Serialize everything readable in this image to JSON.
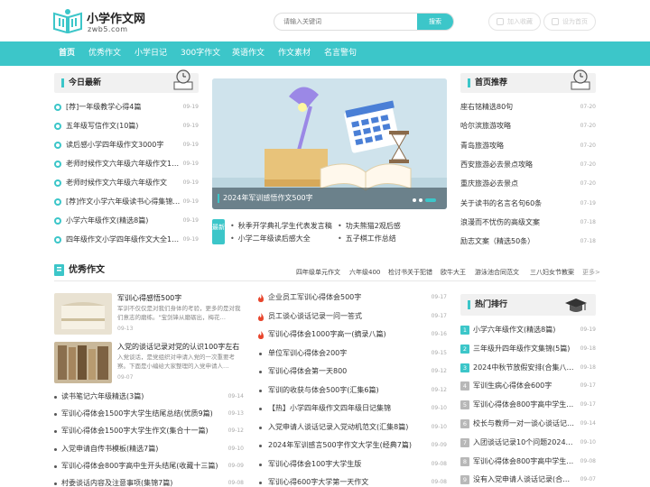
{
  "site": {
    "title": "小学作文网",
    "subtitle": "zwb5.com",
    "search_placeholder": "请输入关键词",
    "search_button": "搜索",
    "btn_favorite": "加入收藏",
    "btn_home": "设为首页"
  },
  "colors": {
    "accent": "#3cc6c9"
  },
  "nav": [
    "首页",
    "优秀作文",
    "小学日记",
    "300字作文",
    "英语作文",
    "作文素材",
    "名言警句"
  ],
  "latest": {
    "title": "今日最新",
    "items": [
      {
        "text": "[荐]一年级教学心得4篇",
        "date": "09-19"
      },
      {
        "text": "五年级写信作文(10篇)",
        "date": "09-19"
      },
      {
        "text": "读后感小学四年级作文3000字",
        "date": "09-19"
      },
      {
        "text": "老师时候作文六年级六年级作文1…",
        "date": "09-19"
      },
      {
        "text": "老师时候作文六年级六年级作文",
        "date": "09-19"
      },
      {
        "text": "[荐]作文小学六年级读书心得集锦…",
        "date": "09-19"
      },
      {
        "text": "小学六年级作文(精选8篇)",
        "date": "09-19"
      },
      {
        "text": "四年级作文小学四年级作文大全1…",
        "date": "09-19"
      }
    ]
  },
  "banner": {
    "caption": "2024年军训感悟作文500字"
  },
  "newest": {
    "badge": "最新",
    "items": [
      "秋季开学典礼学生代表发言稿",
      "功夫熊猫2观后感",
      "小学二年级读后感大全",
      "五子棋工作总结"
    ]
  },
  "recommend": {
    "title": "首页推荐",
    "items": [
      {
        "text": "座右铭精选80句",
        "date": "07-20"
      },
      {
        "text": "哈尔滨旅游攻略",
        "date": "07-20"
      },
      {
        "text": "青岛旅游攻略",
        "date": "07-20"
      },
      {
        "text": "西安旅游必去景点攻略",
        "date": "07-20"
      },
      {
        "text": "重庆旅游必去景点",
        "date": "07-20"
      },
      {
        "text": "关于读书的名言名句60条",
        "date": "07-19"
      },
      {
        "text": "浪漫而不忧伤的高级文案",
        "date": "07-18"
      },
      {
        "text": "励志文案（精选50条）",
        "date": "07-18"
      }
    ]
  },
  "excellent": {
    "title": "优秀作文",
    "tags": [
      "四年级单元作文",
      "六年级400",
      "检讨书关于犯错",
      "欧牛大王",
      "游泳池合同范文",
      "三八妇女节教案",
      "更多>"
    ],
    "cards": [
      {
        "title": "军训心得感悟500字",
        "desc": "军训不仅仅是对我们身体的考验，更多的是对我们意志的磨练。\"宝剑锋从磨砺出，梅花…",
        "date": "09-13"
      },
      {
        "title": "入党的谈话记录对党的认识100字左右",
        "desc": "入党谈话，是党组织对申请入党的一次重要考察。下面是小编给大家整理的入党申请人…",
        "date": "09-07"
      }
    ],
    "left_list": [
      {
        "text": "读书笔记六年级精选(3篇)",
        "date": "09-14"
      },
      {
        "text": "军训心得体会1500字大学生结尾总结(优质9篇)",
        "date": "09-13"
      },
      {
        "text": "军训心得体会1500字大学生作文(集合十一篇)",
        "date": "09-12"
      },
      {
        "text": "入党申请自传书模板(精选7篇)",
        "date": "09-10"
      },
      {
        "text": "军训心得体会800字高中生开头结尾(收藏十三篇)",
        "date": "09-09"
      },
      {
        "text": "村委谈话内容及注意事项(集锦7篇)",
        "date": "09-08"
      }
    ],
    "mid_list": [
      {
        "text": "企业员工军训心得体会500字",
        "date": "09-17",
        "hot": true
      },
      {
        "text": "员工谈心谈话记录一问一答式",
        "date": "09-17",
        "hot": true
      },
      {
        "text": "军训心得体会1000字高一(摘录八篇)",
        "date": "09-16",
        "hot": true
      },
      {
        "text": "单位军训心得体会200字",
        "date": "09-15",
        "hot": false
      },
      {
        "text": "军训心得体会第一天800",
        "date": "09-12",
        "hot": false
      },
      {
        "text": "军训的收获与体会500字(汇集6篇)",
        "date": "09-12",
        "hot": false
      },
      {
        "text": "【热】小学四年级作文四年级日记集锦",
        "date": "09-10",
        "hot": false
      },
      {
        "text": "入党申请人谈话记录入党动机范文(汇集8篇)",
        "date": "09-10",
        "hot": false
      },
      {
        "text": "2024年军训感言500字作文大学生(经典7篇)",
        "date": "09-09",
        "hot": false
      },
      {
        "text": "军训心得体会100字大学生版",
        "date": "09-08",
        "hot": false
      },
      {
        "text": "军训心得600字大学第一天作文",
        "date": "09-08",
        "hot": false
      }
    ]
  },
  "ranking": {
    "title": "热门排行",
    "items": [
      {
        "num": "1",
        "text": "小学六年级作文(精选8篇)",
        "date": "09-19"
      },
      {
        "num": "2",
        "text": "三年级升四年级作文集锦(5篇)",
        "date": "09-18"
      },
      {
        "num": "3",
        "text": "2024中秋节放假安排(合集八篇)",
        "date": "09-18"
      },
      {
        "num": "4",
        "text": "军训生病心得体会600字",
        "date": "09-17"
      },
      {
        "num": "5",
        "text": "军训心得体会800字高中学生…",
        "date": "09-17"
      },
      {
        "num": "6",
        "text": "校长与教师一对一谈心谈话记…",
        "date": "09-14"
      },
      {
        "num": "7",
        "text": "入团谈话记录10个问题2024(…",
        "date": "09-10"
      },
      {
        "num": "8",
        "text": "军训心得体会800字高中学生…",
        "date": "09-08"
      },
      {
        "num": "9",
        "text": "没有入党申请人谈话记录(合集…",
        "date": "09-07"
      }
    ]
  }
}
